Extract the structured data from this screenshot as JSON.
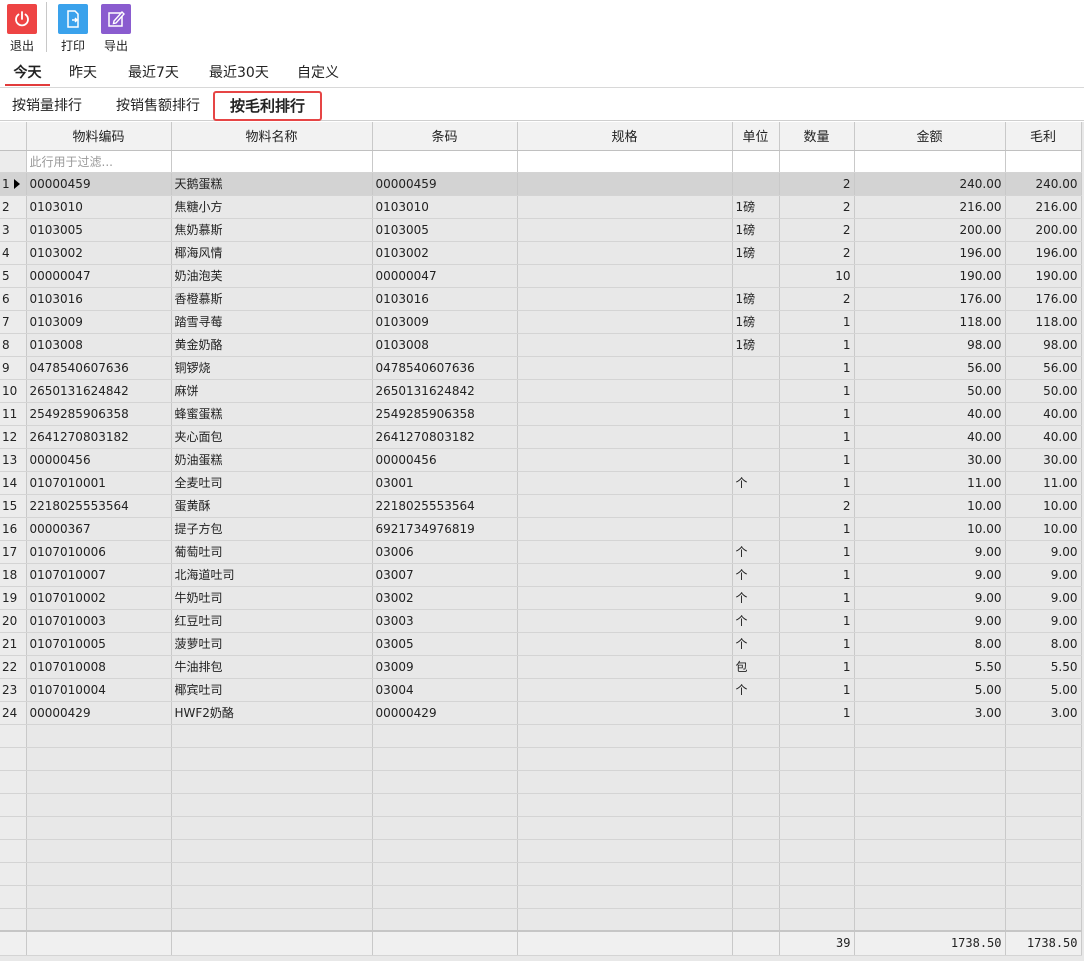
{
  "toolbar": {
    "exit_label": "退出",
    "print_label": "打印",
    "export_label": "导出",
    "exit_color": "#ee4444",
    "print_color": "#3aa2ec",
    "export_color": "#8a5ccf"
  },
  "date_tabs": [
    "今天",
    "昨天",
    "最近7天",
    "最近30天",
    "自定义"
  ],
  "rank_tabs": [
    "按销量排行",
    "按销售额排行",
    "按毛利排行"
  ],
  "grid": {
    "columns": [
      "物料编码",
      "物料名称",
      "条码",
      "规格",
      "单位",
      "数量",
      "金额",
      "毛利"
    ],
    "filter_placeholder": "此行用于过滤...",
    "rows": [
      [
        "1",
        "00000459",
        "天鹅蛋糕",
        "00000459",
        "",
        "",
        "2",
        "240.00",
        "240.00"
      ],
      [
        "2",
        "0103010",
        "焦糖小方",
        "0103010",
        "",
        "1磅",
        "2",
        "216.00",
        "216.00"
      ],
      [
        "3",
        "0103005",
        "焦奶慕斯",
        "0103005",
        "",
        "1磅",
        "2",
        "200.00",
        "200.00"
      ],
      [
        "4",
        "0103002",
        "椰海风情",
        "0103002",
        "",
        "1磅",
        "2",
        "196.00",
        "196.00"
      ],
      [
        "5",
        "00000047",
        "奶油泡芙",
        "00000047",
        "",
        "",
        "10",
        "190.00",
        "190.00"
      ],
      [
        "6",
        "0103016",
        "香橙慕斯",
        "0103016",
        "",
        "1磅",
        "2",
        "176.00",
        "176.00"
      ],
      [
        "7",
        "0103009",
        "踏雪寻莓",
        "0103009",
        "",
        "1磅",
        "1",
        "118.00",
        "118.00"
      ],
      [
        "8",
        "0103008",
        "黄金奶酪",
        "0103008",
        "",
        "1磅",
        "1",
        "98.00",
        "98.00"
      ],
      [
        "9",
        "0478540607636",
        "铜锣烧",
        "0478540607636",
        "",
        "",
        "1",
        "56.00",
        "56.00"
      ],
      [
        "10",
        "2650131624842",
        "麻饼",
        "2650131624842",
        "",
        "",
        "1",
        "50.00",
        "50.00"
      ],
      [
        "11",
        "2549285906358",
        "蜂蜜蛋糕",
        "2549285906358",
        "",
        "",
        "1",
        "40.00",
        "40.00"
      ],
      [
        "12",
        "2641270803182",
        "夹心面包",
        "2641270803182",
        "",
        "",
        "1",
        "40.00",
        "40.00"
      ],
      [
        "13",
        "00000456",
        "奶油蛋糕",
        "00000456",
        "",
        "",
        "1",
        "30.00",
        "30.00"
      ],
      [
        "14",
        "0107010001",
        "全麦吐司",
        "03001",
        "",
        "个",
        "1",
        "11.00",
        "11.00"
      ],
      [
        "15",
        "2218025553564",
        "蛋黄酥",
        "2218025553564",
        "",
        "",
        "2",
        "10.00",
        "10.00"
      ],
      [
        "16",
        "00000367",
        "提子方包",
        "6921734976819",
        "",
        "",
        "1",
        "10.00",
        "10.00"
      ],
      [
        "17",
        "0107010006",
        "葡萄吐司",
        "03006",
        "",
        "个",
        "1",
        "9.00",
        "9.00"
      ],
      [
        "18",
        "0107010007",
        "北海道吐司",
        "03007",
        "",
        "个",
        "1",
        "9.00",
        "9.00"
      ],
      [
        "19",
        "0107010002",
        "牛奶吐司",
        "03002",
        "",
        "个",
        "1",
        "9.00",
        "9.00"
      ],
      [
        "20",
        "0107010003",
        "红豆吐司",
        "03003",
        "",
        "个",
        "1",
        "9.00",
        "9.00"
      ],
      [
        "21",
        "0107010005",
        "菠萝吐司",
        "03005",
        "",
        "个",
        "1",
        "8.00",
        "8.00"
      ],
      [
        "22",
        "0107010008",
        "牛油排包",
        "03009",
        "",
        "包",
        "1",
        "5.50",
        "5.50"
      ],
      [
        "23",
        "0107010004",
        "椰宾吐司",
        "03004",
        "",
        "个",
        "1",
        "5.00",
        "5.00"
      ],
      [
        "24",
        "00000429",
        "HWF2奶酪",
        "00000429",
        "",
        "",
        "1",
        "3.00",
        "3.00"
      ]
    ],
    "totals": {
      "qty": "39",
      "amount": "1738.50",
      "profit": "1738.50"
    }
  }
}
